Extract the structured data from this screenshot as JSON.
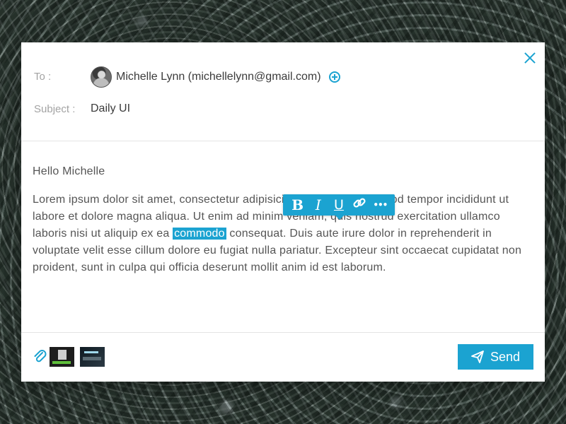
{
  "compose": {
    "to_label": "To :",
    "subject_label": "Subject :",
    "recipient": "Michelle Lynn (michellelynn@gmail.com)",
    "subject": "Daily UI"
  },
  "message": {
    "greeting": "Hello Michelle",
    "text_before": "Lorem ipsum dolor sit amet, consectetur adipisicing elit, sed do eiusmod tempor incididunt ut labore et dolore magna aliqua. Ut enim ad minim veniam, quis nostrud exercitation ullamco laboris nisi ut aliquip ex ea ",
    "selected_word": "commodo",
    "text_after": " consequat. Duis aute irure dolor in reprehenderit in voluptate velit esse cillum dolore eu fugiat nulla pariatur. Excepteur sint occaecat cupidatat non proident, sunt in culpa qui officia deserunt mollit anim id est laborum."
  },
  "toolbar": {
    "bold": "B",
    "italic": "I",
    "underline": "U",
    "more": "•••"
  },
  "actions": {
    "send_label": "Send"
  },
  "icons": {
    "close": "close-icon",
    "add": "plus-circle-icon",
    "attach": "paperclip-icon",
    "link": "link-icon",
    "send": "paper-plane-icon"
  },
  "colors": {
    "accent": "#1ba3d1",
    "text": "#555555",
    "label": "#a3a3a3"
  }
}
